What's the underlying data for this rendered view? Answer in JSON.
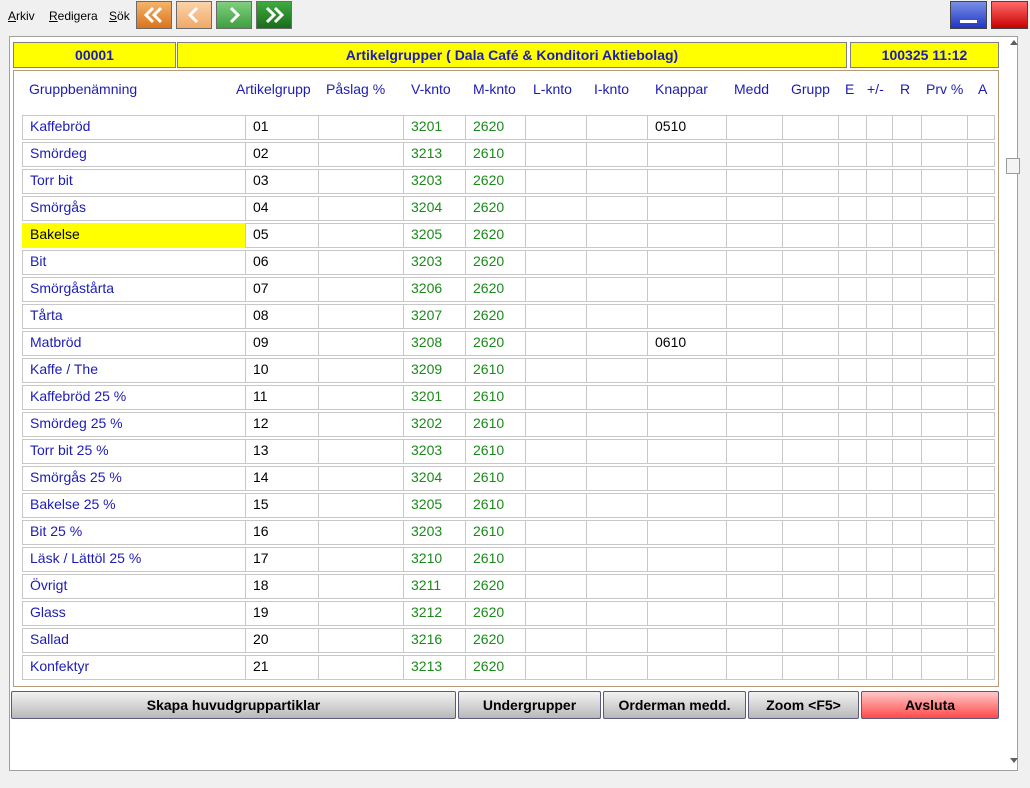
{
  "menu": [
    {
      "u": "A",
      "rest": "rkiv"
    },
    {
      "u": "R",
      "rest": "edigera"
    },
    {
      "u": "S",
      "rest": "ök"
    }
  ],
  "nav_icons": [
    "first-record-icon",
    "previous-record-icon",
    "next-record-icon",
    "last-record-icon"
  ],
  "header": {
    "record_no": "00001",
    "title": "Artikelgrupper ( Dala Café & Konditori Aktiebolag)",
    "datetime": "100325 11:12"
  },
  "columns": [
    "Gruppbenämning",
    "Artikelgrupp",
    "Påslag %",
    "V-knto",
    "M-knto",
    "L-knto",
    "I-knto",
    "Knappar",
    "Medd",
    "Grupp",
    "E",
    "+/-",
    "R",
    "Prv %",
    "A"
  ],
  "rows": [
    {
      "name": "Kaffebröd",
      "grp": "01",
      "vk": "3201",
      "mk": "2620",
      "knappar": "0510"
    },
    {
      "name": "Smördeg",
      "grp": "02",
      "vk": "3213",
      "mk": "2610",
      "knappar": ""
    },
    {
      "name": "Torr bit",
      "grp": "03",
      "vk": "3203",
      "mk": "2620",
      "knappar": ""
    },
    {
      "name": "Smörgås",
      "grp": "04",
      "vk": "3204",
      "mk": "2620",
      "knappar": ""
    },
    {
      "name": "Bakelse",
      "grp": "05",
      "vk": "3205",
      "mk": "2620",
      "knappar": ""
    },
    {
      "name": "Bit",
      "grp": "06",
      "vk": "3203",
      "mk": "2620",
      "knappar": ""
    },
    {
      "name": "Smörgåstårta",
      "grp": "07",
      "vk": "3206",
      "mk": "2620",
      "knappar": ""
    },
    {
      "name": "Tårta",
      "grp": "08",
      "vk": "3207",
      "mk": "2620",
      "knappar": ""
    },
    {
      "name": "Matbröd",
      "grp": "09",
      "vk": "3208",
      "mk": "2620",
      "knappar": "0610"
    },
    {
      "name": "Kaffe / The",
      "grp": "10",
      "vk": "3209",
      "mk": "2610",
      "knappar": ""
    },
    {
      "name": "Kaffebröd 25 %",
      "grp": "11",
      "vk": "3201",
      "mk": "2610",
      "knappar": ""
    },
    {
      "name": "Smördeg 25 %",
      "grp": "12",
      "vk": "3202",
      "mk": "2610",
      "knappar": ""
    },
    {
      "name": "Torr bit 25 %",
      "grp": "13",
      "vk": "3203",
      "mk": "2610",
      "knappar": ""
    },
    {
      "name": "Smörgås 25 %",
      "grp": "14",
      "vk": "3204",
      "mk": "2610",
      "knappar": ""
    },
    {
      "name": "Bakelse 25 %",
      "grp": "15",
      "vk": "3205",
      "mk": "2610",
      "knappar": ""
    },
    {
      "name": "Bit 25 %",
      "grp": "16",
      "vk": "3203",
      "mk": "2610",
      "knappar": ""
    },
    {
      "name": "Läsk / Lättöl 25 %",
      "grp": "17",
      "vk": "3210",
      "mk": "2610",
      "knappar": ""
    },
    {
      "name": "Övrigt",
      "grp": "18",
      "vk": "3211",
      "mk": "2620",
      "knappar": ""
    },
    {
      "name": "Glass",
      "grp": "19",
      "vk": "3212",
      "mk": "2620",
      "knappar": ""
    },
    {
      "name": "Sallad",
      "grp": "20",
      "vk": "3216",
      "mk": "2620",
      "knappar": ""
    },
    {
      "name": "Konfektyr",
      "grp": "21",
      "vk": "3213",
      "mk": "2620",
      "knappar": ""
    }
  ],
  "selected_row": 4,
  "buttons": [
    "Skapa huvudgruppartiklar",
    "Undergrupper",
    "Orderman medd.",
    "Zoom <F5>",
    "Avsluta"
  ],
  "colors": {
    "header_yellow": "#ffff00",
    "text_blue": "#1c1cb4",
    "text_green": "#1a8a1a",
    "selected_row": "#ffff00"
  }
}
